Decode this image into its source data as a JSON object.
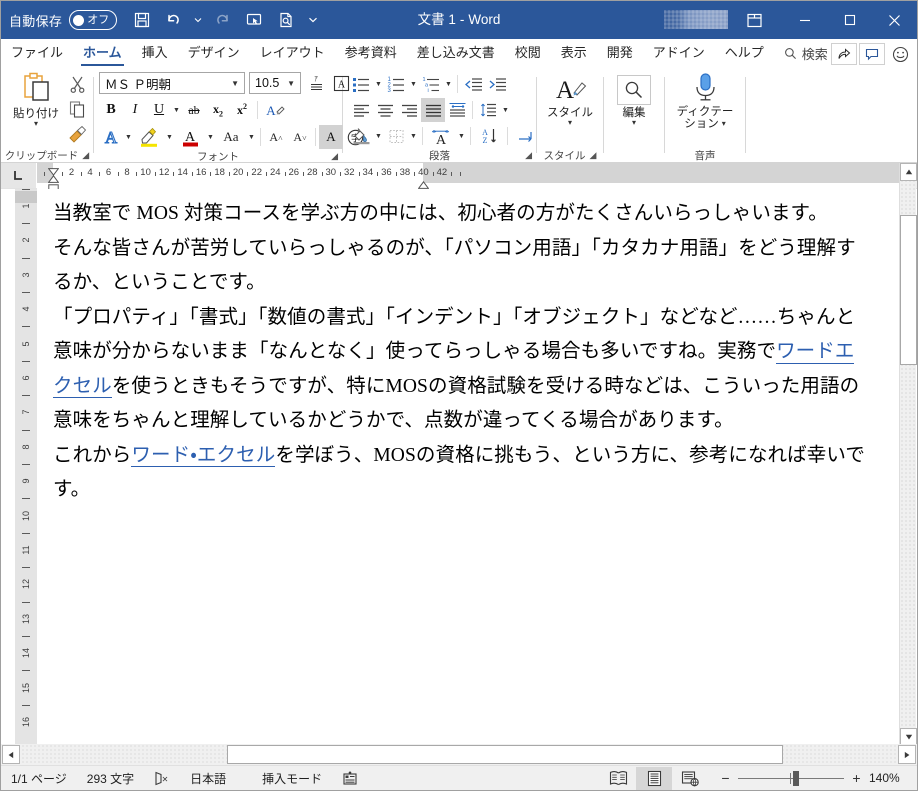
{
  "titlebar": {
    "autosave_label": "自動保存",
    "autosave_state": "オフ",
    "document_title": "文書 1",
    "title_separator": "-",
    "app_name": "Word",
    "quick_access": [
      {
        "name": "save-button",
        "icon": "save-icon"
      },
      {
        "name": "undo-button",
        "icon": "undo-icon"
      },
      {
        "name": "redo-button",
        "icon": "redo-icon"
      },
      {
        "name": "touch-mode-button",
        "icon": "touch-pointer-icon"
      },
      {
        "name": "print-preview-button",
        "icon": "print-preview-icon"
      },
      {
        "name": "customize-qat-button",
        "icon": "chevron-down-icon"
      }
    ],
    "window_controls": [
      {
        "name": "ribbon-display-options-button",
        "icon": "ribbon-display-icon"
      },
      {
        "name": "minimize-button",
        "icon": "minimize-icon"
      },
      {
        "name": "maximize-button",
        "icon": "maximize-icon"
      },
      {
        "name": "close-button",
        "icon": "close-icon"
      }
    ]
  },
  "tabs": [
    {
      "label": "ファイル",
      "active": false
    },
    {
      "label": "ホーム",
      "active": true
    },
    {
      "label": "挿入",
      "active": false
    },
    {
      "label": "デザイン",
      "active": false
    },
    {
      "label": "レイアウト",
      "active": false
    },
    {
      "label": "参考資料",
      "active": false
    },
    {
      "label": "差し込み文書",
      "active": false
    },
    {
      "label": "校閲",
      "active": false
    },
    {
      "label": "表示",
      "active": false
    },
    {
      "label": "開発",
      "active": false
    },
    {
      "label": "アドイン",
      "active": false
    },
    {
      "label": "ヘルプ",
      "active": false
    }
  ],
  "search": {
    "label": "検索",
    "icon": "search-icon"
  },
  "tabstrip_right": [
    {
      "name": "share-button",
      "icon": "share-icon"
    },
    {
      "name": "comments-button",
      "icon": "comment-icon"
    },
    {
      "name": "feedback-button",
      "icon": "smiley-icon"
    }
  ],
  "ribbon": {
    "groups": [
      {
        "name": "clipboard",
        "label": "クリップボード",
        "has_dialog_launcher": true,
        "paste_label": "貼り付け",
        "commands": [
          {
            "name": "paste-button",
            "icon": "clipboard-icon",
            "label": "貼り付け"
          },
          {
            "name": "cut-button",
            "icon": "scissors-icon"
          },
          {
            "name": "copy-button",
            "icon": "copy-icon"
          },
          {
            "name": "format-painter-button",
            "icon": "paintbrush-icon"
          }
        ]
      },
      {
        "name": "font",
        "label": "フォント",
        "has_dialog_launcher": true,
        "font_name": "ＭＳ Ｐ明朝",
        "font_size": "10.5",
        "commands": [
          {
            "name": "phonetic-guide-button",
            "icon": "ruby-icon"
          },
          {
            "name": "enclose-character-button",
            "icon": "enclose-char-icon"
          },
          {
            "name": "bold-button",
            "icon": "bold-icon",
            "label": "B"
          },
          {
            "name": "italic-button",
            "icon": "italic-icon",
            "label": "I"
          },
          {
            "name": "underline-button",
            "icon": "underline-icon",
            "label": "U"
          },
          {
            "name": "strikethrough-button",
            "icon": "strikethrough-icon"
          },
          {
            "name": "subscript-button",
            "icon": "subscript-icon"
          },
          {
            "name": "superscript-button",
            "icon": "superscript-icon"
          },
          {
            "name": "clear-formatting-button",
            "icon": "clear-format-icon"
          },
          {
            "name": "text-effects-button",
            "icon": "text-effects-icon"
          },
          {
            "name": "text-highlight-color-button",
            "icon": "highlighter-icon"
          },
          {
            "name": "font-color-button",
            "icon": "font-color-icon"
          },
          {
            "name": "change-case-button",
            "icon": "change-case-icon"
          },
          {
            "name": "grow-font-button",
            "icon": "grow-font-icon"
          },
          {
            "name": "shrink-font-button",
            "icon": "shrink-font-icon"
          },
          {
            "name": "character-shading-button",
            "icon": "char-shading-icon"
          },
          {
            "name": "character-border-button",
            "icon": "char-border-icon"
          }
        ]
      },
      {
        "name": "paragraph",
        "label": "段落",
        "has_dialog_launcher": true,
        "commands": [
          {
            "name": "bullets-button",
            "icon": "bullet-list-icon"
          },
          {
            "name": "numbering-button",
            "icon": "numbered-list-icon"
          },
          {
            "name": "multilevel-list-button",
            "icon": "multilevel-list-icon"
          },
          {
            "name": "decrease-indent-button",
            "icon": "decrease-indent-icon"
          },
          {
            "name": "increase-indent-button",
            "icon": "increase-indent-icon"
          },
          {
            "name": "align-left-button",
            "icon": "align-left-icon"
          },
          {
            "name": "align-center-button",
            "icon": "align-center-icon"
          },
          {
            "name": "align-right-button",
            "icon": "align-right-icon"
          },
          {
            "name": "justify-button",
            "icon": "justify-icon",
            "selected": true
          },
          {
            "name": "distribute-button",
            "icon": "distribute-icon"
          },
          {
            "name": "line-spacing-button",
            "icon": "line-spacing-icon"
          },
          {
            "name": "shading-button",
            "icon": "shading-icon"
          },
          {
            "name": "borders-button",
            "icon": "borders-icon"
          },
          {
            "name": "character-spacing-button",
            "icon": "char-spacing-icon"
          },
          {
            "name": "sort-button",
            "icon": "sort-az-icon"
          },
          {
            "name": "show-formatting-marks-button",
            "icon": "pilcrow-icon"
          }
        ]
      },
      {
        "name": "styles",
        "label": "スタイル",
        "has_dialog_launcher": true,
        "button_label": "スタイル",
        "icon": "styles-icon"
      },
      {
        "name": "editing",
        "label": "",
        "has_dialog_launcher": false,
        "button_label": "編集",
        "icon": "magnifier-icon"
      },
      {
        "name": "voice",
        "label": "音声",
        "has_dialog_launcher": false,
        "button_label_line1": "ディクテー",
        "button_label_line2": "ション",
        "icon": "microphone-icon"
      }
    ]
  },
  "ruler": {
    "tab_stop_selector_icon": "left-tab-stop-icon",
    "numbers": [
      2,
      4,
      6,
      8,
      10,
      12,
      14,
      16,
      18,
      20,
      22,
      24,
      26,
      28,
      30,
      32,
      34,
      36,
      38,
      40,
      42
    ],
    "vertical_numbers": [
      1,
      2,
      3,
      4,
      5,
      6,
      7,
      8,
      9,
      10,
      11,
      12,
      13,
      14,
      15,
      16
    ],
    "first_line_indent_marker": "first-line-indent-marker",
    "hanging_indent_marker": "hanging-indent-marker",
    "left_indent_marker": "left-indent-marker",
    "right_indent_marker": "right-indent-marker"
  },
  "document": {
    "paragraphs": [
      {
        "id": "p1",
        "runs": [
          {
            "text": "当教室で MOS 対策コースを学ぶ方の中には、初心者の方がたくさんいらっしゃいます。",
            "link": false
          }
        ]
      },
      {
        "id": "p2",
        "runs": [
          {
            "text": "そんな皆さんが苦労していらっしゃるのが、「パソコン用語」「カタカナ用語」をどう理解するか、ということです。",
            "link": false
          }
        ]
      },
      {
        "id": "p3",
        "runs": [
          {
            "text": "「プロパティ」「書式」「数値の書式」「インデント」「オブジェクト」などなど……ちゃんと意味が分からないまま「なんとなく」使ってらっしゃる場合も多いですね。実務で",
            "link": false
          },
          {
            "text": "ワードエクセル",
            "link": true
          },
          {
            "text": "を使うときもそうですが、特にMOSの資格試験を受ける時などは、こういった用語の意味をちゃんと理解しているかどうかで、点数が違ってくる場合があります。",
            "link": false
          }
        ]
      },
      {
        "id": "p4",
        "runs": [
          {
            "text": "これから",
            "link": false
          },
          {
            "text": "ワード・エクセル",
            "link": true
          },
          {
            "text": "を学ぼう、MOSの資格に挑もう、という方に、参考になれば幸いです。",
            "link": false
          }
        ]
      }
    ],
    "link_color": "#2d5fb0"
  },
  "statusbar": {
    "page_info": "1/1 ページ",
    "word_count": "293 文字",
    "proofing_icon": "proofing-errors-icon",
    "language": "日本語",
    "insert_mode": "挿入モード",
    "accessibility_icon": "accessibility-icon",
    "views": [
      {
        "name": "read-mode-button",
        "icon": "read-mode-icon",
        "active": false
      },
      {
        "name": "print-layout-button",
        "icon": "print-layout-icon",
        "active": true
      },
      {
        "name": "web-layout-button",
        "icon": "web-layout-icon",
        "active": false
      }
    ],
    "zoom_out_label": "−",
    "zoom_in_label": "+",
    "zoom_level": "140%"
  },
  "colors": {
    "titlebar": "#2b579a",
    "accent": "#2b579a",
    "ribbon_bg": "#ffffff",
    "statusbar_bg": "#f0f0f0",
    "link": "#2d5fb0",
    "icon_blue": "#2b579a"
  }
}
